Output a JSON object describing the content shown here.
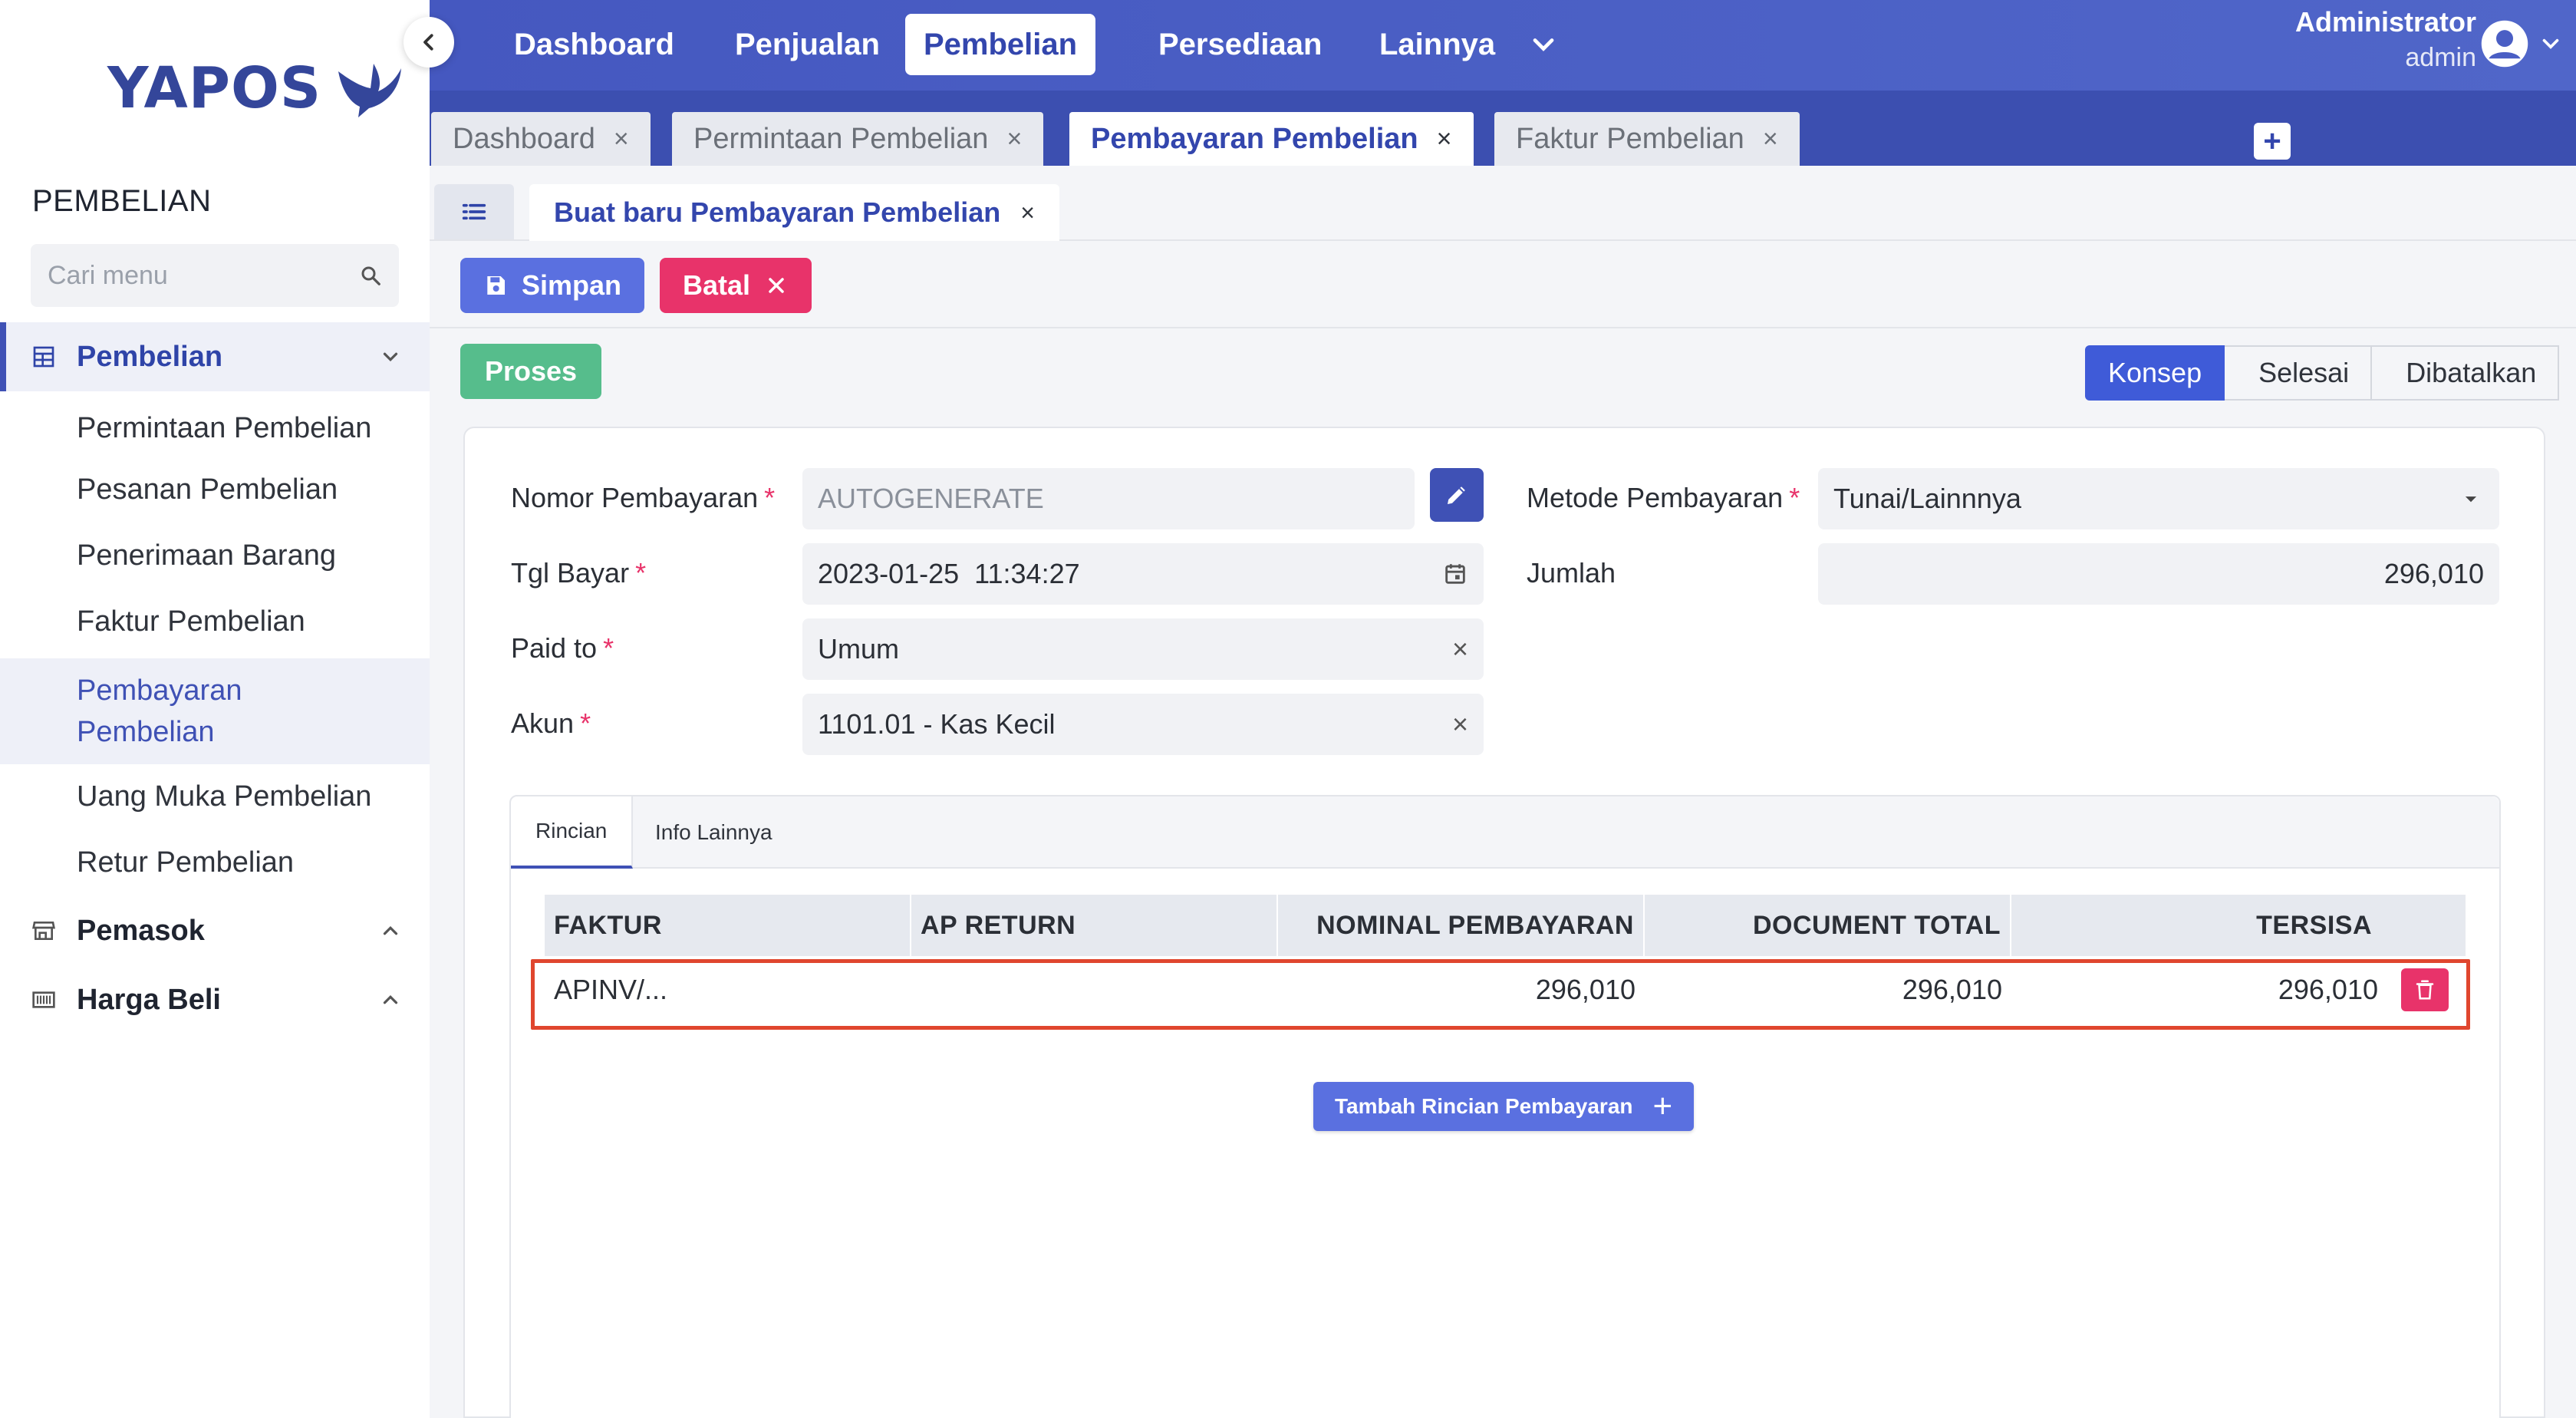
{
  "app": {
    "logo_text": "YAPOS",
    "colors": {
      "primary": "#3f51b5",
      "danger": "#e8336a",
      "success": "#56bd8c",
      "highlight": "#e0462e"
    }
  },
  "sidebar": {
    "section_title": "PEMBELIAN",
    "search_placeholder": "Cari menu",
    "groups": [
      {
        "label": "Pembelian",
        "icon": "table-icon",
        "expanded": true
      },
      {
        "label": "Pemasok",
        "icon": "store-icon",
        "expanded": false
      },
      {
        "label": "Harga Beli",
        "icon": "barcode-icon",
        "expanded": false
      }
    ],
    "items": [
      {
        "label": "Permintaan Pembelian"
      },
      {
        "label": "Pesanan Pembelian"
      },
      {
        "label": "Penerimaan Barang"
      },
      {
        "label": "Faktur Pembelian"
      },
      {
        "label": "Pembayaran Pembelian",
        "line1": "Pembayaran",
        "line2": "Pembelian",
        "active": true
      },
      {
        "label": "Uang Muka Pembelian"
      },
      {
        "label": "Retur Pembelian"
      }
    ]
  },
  "topnav": {
    "items": [
      "Dashboard",
      "Penjualan",
      "Pembelian",
      "Persediaan",
      "Lainnya"
    ],
    "active": "Pembelian",
    "user_name": "Administrator",
    "user_role": "admin"
  },
  "doc_tabs": [
    {
      "label": "Dashboard",
      "close": "×"
    },
    {
      "label": "Permintaan Pembelian",
      "close": "×"
    },
    {
      "label": "Pembayaran Pembelian",
      "close": "×",
      "active": true
    },
    {
      "label": "Faktur Pembelian",
      "close": "×"
    }
  ],
  "doc_tab_add": "+",
  "form_tab": {
    "label": "Buat baru Pembayaran Pembelian",
    "close": "×"
  },
  "toolbar": {
    "save_label": "Simpan",
    "cancel_label": "Batal"
  },
  "process_label": "Proses",
  "status_steps": [
    {
      "label": "Konsep",
      "active": true
    },
    {
      "label": "Selesai"
    },
    {
      "label": "Dibatalkan"
    }
  ],
  "form": {
    "nomor": {
      "label": "Nomor Pembayaran",
      "placeholder": "AUTOGENERATE"
    },
    "tgl": {
      "label": "Tgl Bayar",
      "value": "2023-01-25  11:34:27"
    },
    "paid_to": {
      "label": "Paid to",
      "value": "Umum"
    },
    "akun": {
      "label": "Akun",
      "value": "1101.01 - Kas Kecil"
    },
    "metode": {
      "label": "Metode Pembayaran",
      "value": "Tunai/Lainnnya"
    },
    "jumlah": {
      "label": "Jumlah",
      "value": "296,010"
    },
    "required_mark": "*",
    "clear_mark": "×"
  },
  "detail": {
    "tabs": [
      "Rincian",
      "Info Lainnya"
    ],
    "active_tab": "Rincian",
    "columns": [
      "FAKTUR",
      "AP RETURN",
      "NOMINAL PEMBAYARAN",
      "DOCUMENT TOTAL",
      "TERSISA"
    ],
    "rows": [
      {
        "faktur": "APINV/...",
        "ap_return": "",
        "nominal": "296,010",
        "total": "296,010",
        "tersisa": "296,010"
      }
    ],
    "add_label": "Tambah Rincian Pembayaran",
    "add_icon": "+"
  }
}
